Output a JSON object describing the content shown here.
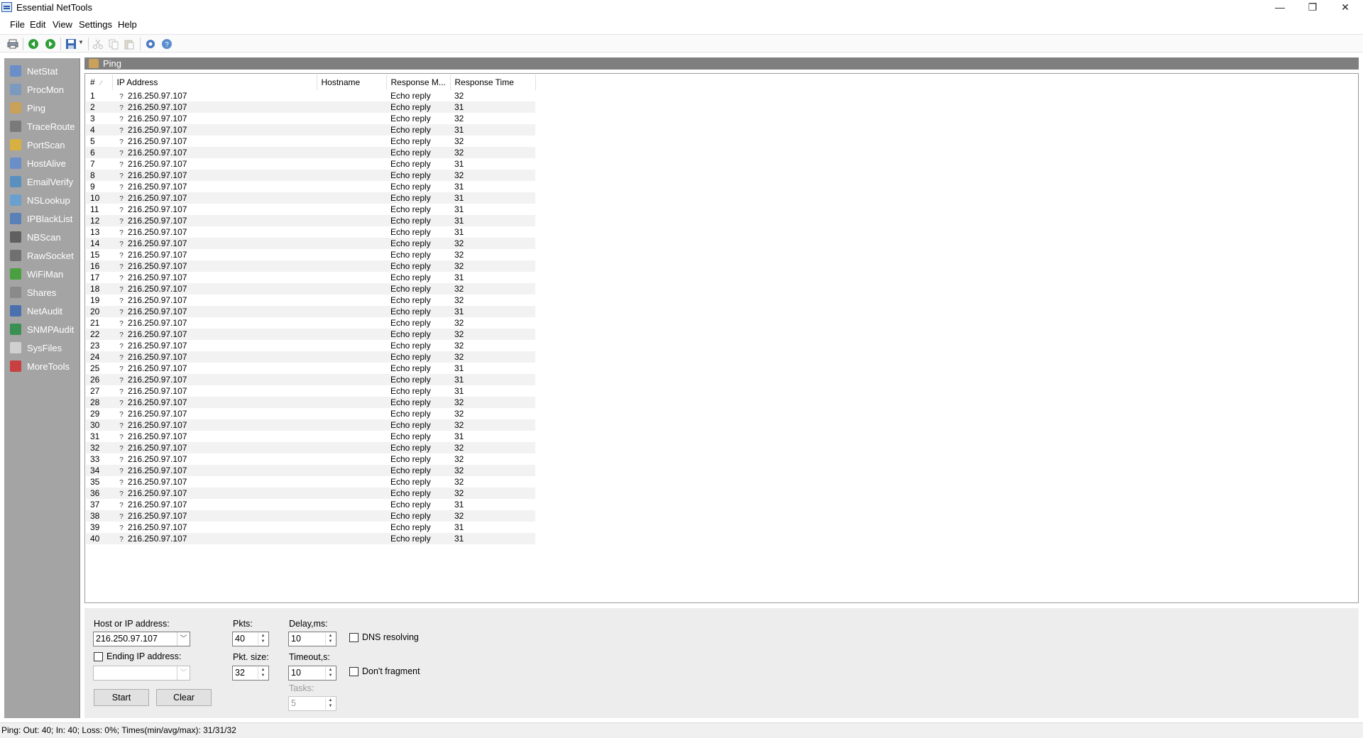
{
  "window": {
    "title": "Essential NetTools",
    "minimize": "—",
    "maximize": "❐",
    "close": "✕"
  },
  "menu": [
    "File",
    "Edit",
    "View",
    "Settings",
    "Help"
  ],
  "toolbar": {
    "icons": [
      "print-icon",
      "back-icon",
      "forward-icon",
      "save-icon",
      "cut-icon",
      "copy-icon",
      "paste-icon",
      "settings-icon",
      "help-icon"
    ]
  },
  "sidebar": {
    "items": [
      {
        "label": "NetStat",
        "icon": "netstat-icon",
        "color": "#6a8fc8"
      },
      {
        "label": "ProcMon",
        "icon": "procmon-icon",
        "color": "#7a9ac0"
      },
      {
        "label": "Ping",
        "icon": "ping-icon",
        "color": "#c9a15a"
      },
      {
        "label": "TraceRoute",
        "icon": "traceroute-icon",
        "color": "#7a7a7a"
      },
      {
        "label": "PortScan",
        "icon": "portscan-icon",
        "color": "#d8b040"
      },
      {
        "label": "HostAlive",
        "icon": "hostalive-icon",
        "color": "#6a8fc8"
      },
      {
        "label": "EmailVerify",
        "icon": "emailverify-icon",
        "color": "#5a90c0"
      },
      {
        "label": "NSLookup",
        "icon": "nslookup-icon",
        "color": "#6aa0d0"
      },
      {
        "label": "IPBlackList",
        "icon": "ipblacklist-icon",
        "color": "#5a80b8"
      },
      {
        "label": "NBScan",
        "icon": "nbscan-icon",
        "color": "#606060"
      },
      {
        "label": "RawSocket",
        "icon": "rawsocket-icon",
        "color": "#707070"
      },
      {
        "label": "WiFiMan",
        "icon": "wifiman-icon",
        "color": "#4aa040"
      },
      {
        "label": "Shares",
        "icon": "shares-icon",
        "color": "#8a8a8a"
      },
      {
        "label": "NetAudit",
        "icon": "netaudit-icon",
        "color": "#4a70b0"
      },
      {
        "label": "SNMPAudit",
        "icon": "snmpaudit-icon",
        "color": "#3a9050"
      },
      {
        "label": "SysFiles",
        "icon": "sysfiles-icon",
        "color": "#d0d0d0"
      },
      {
        "label": "MoreTools",
        "icon": "moretools-icon",
        "color": "#c84040"
      }
    ],
    "active": "Ping"
  },
  "panel": {
    "title": "Ping"
  },
  "table": {
    "headers": [
      "#",
      "IP Address",
      "Hostname",
      "Response M...",
      "Response Time"
    ],
    "rows": [
      {
        "n": "1",
        "ip": "216.250.97.107",
        "host": "",
        "msg": "Echo reply",
        "time": "32"
      },
      {
        "n": "2",
        "ip": "216.250.97.107",
        "host": "",
        "msg": "Echo reply",
        "time": "31"
      },
      {
        "n": "3",
        "ip": "216.250.97.107",
        "host": "",
        "msg": "Echo reply",
        "time": "32"
      },
      {
        "n": "4",
        "ip": "216.250.97.107",
        "host": "",
        "msg": "Echo reply",
        "time": "31"
      },
      {
        "n": "5",
        "ip": "216.250.97.107",
        "host": "",
        "msg": "Echo reply",
        "time": "32"
      },
      {
        "n": "6",
        "ip": "216.250.97.107",
        "host": "",
        "msg": "Echo reply",
        "time": "32"
      },
      {
        "n": "7",
        "ip": "216.250.97.107",
        "host": "",
        "msg": "Echo reply",
        "time": "31"
      },
      {
        "n": "8",
        "ip": "216.250.97.107",
        "host": "",
        "msg": "Echo reply",
        "time": "32"
      },
      {
        "n": "9",
        "ip": "216.250.97.107",
        "host": "",
        "msg": "Echo reply",
        "time": "31"
      },
      {
        "n": "10",
        "ip": "216.250.97.107",
        "host": "",
        "msg": "Echo reply",
        "time": "31"
      },
      {
        "n": "11",
        "ip": "216.250.97.107",
        "host": "",
        "msg": "Echo reply",
        "time": "31"
      },
      {
        "n": "12",
        "ip": "216.250.97.107",
        "host": "",
        "msg": "Echo reply",
        "time": "31"
      },
      {
        "n": "13",
        "ip": "216.250.97.107",
        "host": "",
        "msg": "Echo reply",
        "time": "31"
      },
      {
        "n": "14",
        "ip": "216.250.97.107",
        "host": "",
        "msg": "Echo reply",
        "time": "32"
      },
      {
        "n": "15",
        "ip": "216.250.97.107",
        "host": "",
        "msg": "Echo reply",
        "time": "32"
      },
      {
        "n": "16",
        "ip": "216.250.97.107",
        "host": "",
        "msg": "Echo reply",
        "time": "32"
      },
      {
        "n": "17",
        "ip": "216.250.97.107",
        "host": "",
        "msg": "Echo reply",
        "time": "31"
      },
      {
        "n": "18",
        "ip": "216.250.97.107",
        "host": "",
        "msg": "Echo reply",
        "time": "32"
      },
      {
        "n": "19",
        "ip": "216.250.97.107",
        "host": "",
        "msg": "Echo reply",
        "time": "32"
      },
      {
        "n": "20",
        "ip": "216.250.97.107",
        "host": "",
        "msg": "Echo reply",
        "time": "31"
      },
      {
        "n": "21",
        "ip": "216.250.97.107",
        "host": "",
        "msg": "Echo reply",
        "time": "32"
      },
      {
        "n": "22",
        "ip": "216.250.97.107",
        "host": "",
        "msg": "Echo reply",
        "time": "32"
      },
      {
        "n": "23",
        "ip": "216.250.97.107",
        "host": "",
        "msg": "Echo reply",
        "time": "32"
      },
      {
        "n": "24",
        "ip": "216.250.97.107",
        "host": "",
        "msg": "Echo reply",
        "time": "32"
      },
      {
        "n": "25",
        "ip": "216.250.97.107",
        "host": "",
        "msg": "Echo reply",
        "time": "31"
      },
      {
        "n": "26",
        "ip": "216.250.97.107",
        "host": "",
        "msg": "Echo reply",
        "time": "31"
      },
      {
        "n": "27",
        "ip": "216.250.97.107",
        "host": "",
        "msg": "Echo reply",
        "time": "31"
      },
      {
        "n": "28",
        "ip": "216.250.97.107",
        "host": "",
        "msg": "Echo reply",
        "time": "32"
      },
      {
        "n": "29",
        "ip": "216.250.97.107",
        "host": "",
        "msg": "Echo reply",
        "time": "32"
      },
      {
        "n": "30",
        "ip": "216.250.97.107",
        "host": "",
        "msg": "Echo reply",
        "time": "32"
      },
      {
        "n": "31",
        "ip": "216.250.97.107",
        "host": "",
        "msg": "Echo reply",
        "time": "31"
      },
      {
        "n": "32",
        "ip": "216.250.97.107",
        "host": "",
        "msg": "Echo reply",
        "time": "32"
      },
      {
        "n": "33",
        "ip": "216.250.97.107",
        "host": "",
        "msg": "Echo reply",
        "time": "32"
      },
      {
        "n": "34",
        "ip": "216.250.97.107",
        "host": "",
        "msg": "Echo reply",
        "time": "32"
      },
      {
        "n": "35",
        "ip": "216.250.97.107",
        "host": "",
        "msg": "Echo reply",
        "time": "32"
      },
      {
        "n": "36",
        "ip": "216.250.97.107",
        "host": "",
        "msg": "Echo reply",
        "time": "32"
      },
      {
        "n": "37",
        "ip": "216.250.97.107",
        "host": "",
        "msg": "Echo reply",
        "time": "31"
      },
      {
        "n": "38",
        "ip": "216.250.97.107",
        "host": "",
        "msg": "Echo reply",
        "time": "32"
      },
      {
        "n": "39",
        "ip": "216.250.97.107",
        "host": "",
        "msg": "Echo reply",
        "time": "31"
      },
      {
        "n": "40",
        "ip": "216.250.97.107",
        "host": "",
        "msg": "Echo reply",
        "time": "31"
      }
    ]
  },
  "form": {
    "host_label": "Host or IP address:",
    "host_value": "216.250.97.107",
    "ending_label": "Ending IP address:",
    "ending_value": "",
    "ending_checked": false,
    "pkts_label": "Pkts:",
    "pkts_value": "40",
    "pktsize_label": "Pkt. size:",
    "pktsize_value": "32",
    "delay_label": "Delay,ms:",
    "delay_value": "10",
    "timeout_label": "Timeout,s:",
    "timeout_value": "10",
    "tasks_label": "Tasks:",
    "tasks_value": "5",
    "dns_label": "DNS resolving",
    "dns_checked": false,
    "fragment_label": "Don't fragment",
    "fragment_checked": false,
    "start_label": "Start",
    "clear_label": "Clear"
  },
  "status": {
    "text": "Ping: Out: 40; In: 40; Loss: 0%; Times(min/avg/max): 31/31/32"
  },
  "colors": {
    "sidebar_bg": "#a4a4a4",
    "panel_header_bg": "#7f7f7f",
    "form_bg": "#ededed"
  }
}
